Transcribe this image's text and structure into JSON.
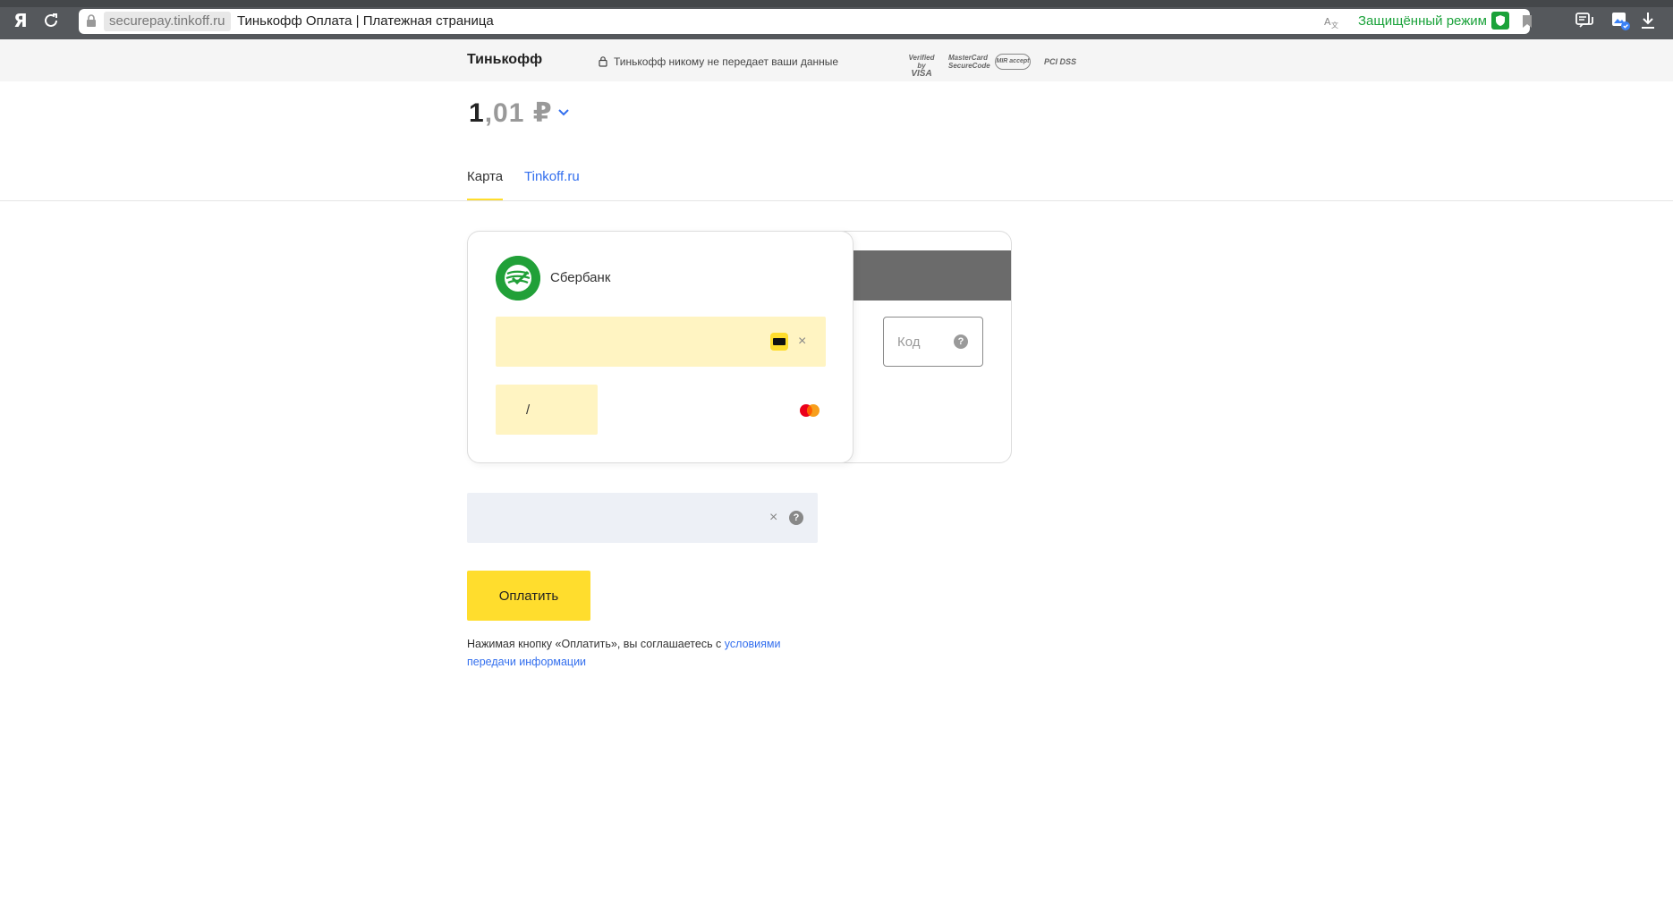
{
  "browser": {
    "logo": "Я",
    "url_domain": "securepay.tinkoff.ru",
    "page_title": "Тинькофф Оплата | Платежная страница",
    "protect_label": "Защищённый режим"
  },
  "header": {
    "brand": "Тинькофф",
    "privacy_text": "Тинькофф никому не передает ваши данные",
    "logos": {
      "visa_top": "Verified by",
      "visa_bottom": "VISA",
      "mc_top": "MasterCard",
      "mc_bottom": "SecureCode",
      "mir": "MIR accept",
      "pci": "PCI DSS"
    }
  },
  "amount": {
    "integer": "1",
    "fraction": ",01 ₽"
  },
  "tabs": {
    "card": "Карта",
    "tinkoff": "Tinkoff.ru"
  },
  "card": {
    "bank_name": "Сбербанк",
    "number_clear": "×",
    "expiry_separator": "/",
    "cvc_placeholder": "Код",
    "help_glyph": "?"
  },
  "email": {
    "clear": "×",
    "help_glyph": "?"
  },
  "pay": {
    "button_label": "Оплатить",
    "agree_prefix": "Нажимая кнопку «Оплатить», вы соглашаетесь с ",
    "agree_link": "условиями передачи информации"
  },
  "colors": {
    "accent": "#ffdd2d",
    "link": "#336fee",
    "sber": "#21a038",
    "protect": "#1aa23a"
  }
}
